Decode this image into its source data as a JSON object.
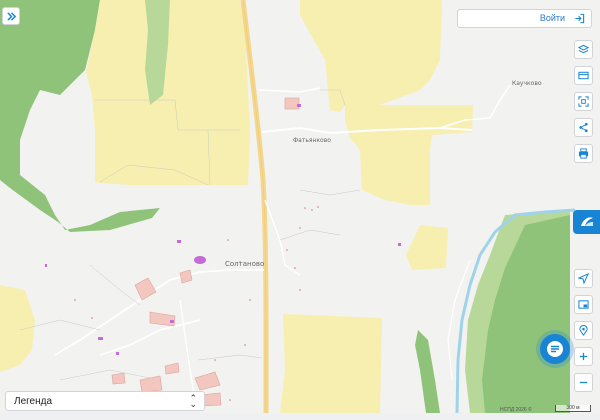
{
  "header": {
    "login_label": "Войти"
  },
  "legend": {
    "label": "Легенда"
  },
  "places": [
    {
      "name": "Каучково"
    },
    {
      "name": "Фатьянково"
    },
    {
      "name": "Солтаново"
    }
  ],
  "footer": {
    "copyright": "НСПД 2026 ©",
    "scale": "300 м"
  },
  "controls": {
    "left_top": [
      "expand-icon"
    ],
    "right_top": [
      "layers-icon",
      "card-icon",
      "scan-icon",
      "share-icon",
      "print-icon"
    ],
    "right_bottom": [
      "locate-icon",
      "minimap-icon",
      "geo-pin-icon",
      "zoom-in-icon",
      "zoom-out-icon"
    ]
  },
  "colors": {
    "background": "#f2f2f0",
    "field_yellow": "#f7efb0",
    "forest_green": "#8fc37a",
    "light_green": "#b8d89a",
    "road_main": "#f5d68a",
    "parcel_pink": "#f3c7c0",
    "accent_blue": "#1a84d4"
  }
}
